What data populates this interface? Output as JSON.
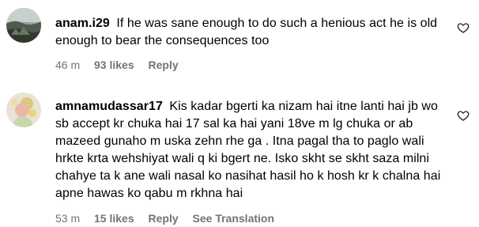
{
  "comments": [
    {
      "username": "anam.i29",
      "text": "If he was sane enough to do such a henious act he is old enough to bear the consequences too",
      "time": "46 m",
      "likes": "93 likes",
      "reply": "Reply"
    },
    {
      "username": "amnamudassar17",
      "text": "Kis kadar bgerti ka nizam hai itne lanti hai jb wo sb accept kr chuka hai 17 sal ka hai yani 18ve m lg chuka or ab mazeed gunaho m uska zehn rhe ga . Itna pagal tha to paglo wali hrkte krta wehshiyat wali q ki bgert ne. Isko skht se skht saza milni chahye ta k ane wali nasal ko nasihat hasil ho k hosh kr k chalna hai apne hawas ko qabu m rkhna hai",
      "time": "53 m",
      "likes": "15 likes",
      "reply": "Reply",
      "see_translation": "See Translation"
    }
  ],
  "colors": {
    "meta_text": "#737373",
    "background": "#ffffff"
  },
  "icons": [
    "avatar-landscape",
    "avatar-person",
    "heart-outline-icon"
  ]
}
